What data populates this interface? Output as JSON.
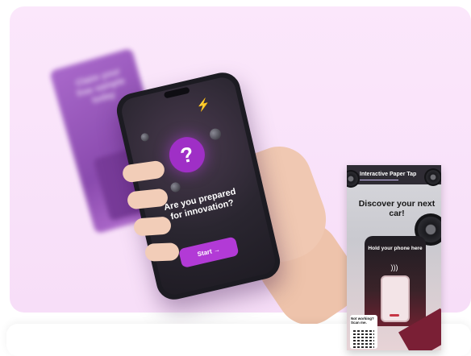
{
  "blurred_card": {
    "text": "Claim your free sample today"
  },
  "phone": {
    "question_mark": "?",
    "headline": "Are you prepared for innovation?",
    "start_button": "Start →"
  },
  "poster": {
    "brand": "Interactive Paper Tap",
    "title": "Discover your next car!",
    "instruction": "Hold your phone here",
    "qr_text": "Not working? Scan me."
  },
  "colors": {
    "hero_background": "#f7def8",
    "accent_purple": "#b23ad6",
    "lightning": "#f3c31d"
  },
  "icons": [
    "question-mark-icon",
    "lightning-icon",
    "nfc-wave-icon",
    "arrow-right-icon",
    "qr-code-icon"
  ]
}
